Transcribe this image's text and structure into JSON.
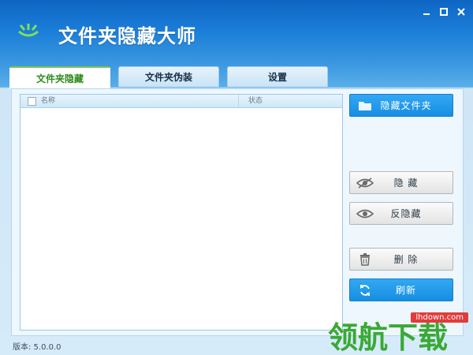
{
  "app": {
    "title": "文件夹隐藏大师",
    "version_label": "版本: 5.0.0.0"
  },
  "window_controls": [
    "minimize-icon",
    "maximize-icon",
    "close-icon"
  ],
  "tabs": [
    {
      "label": "文件夹隐藏",
      "active": true
    },
    {
      "label": "文件夹伪装",
      "active": false
    },
    {
      "label": "设置",
      "active": false
    }
  ],
  "table": {
    "columns": [
      "名称",
      "状态"
    ],
    "rows": []
  },
  "actions": {
    "hide_folder": "隐藏文件夹",
    "hide": "隐 藏",
    "unhide": "反隐藏",
    "delete": "删 除",
    "refresh": "刷新"
  },
  "icons": {
    "hide_folder": "folder-icon",
    "hide": "eye-slash-icon",
    "unhide": "eye-icon",
    "delete": "trash-icon",
    "refresh": "refresh-icon"
  },
  "colors": {
    "accent_blue": "#168fe2",
    "tab_active_text": "#2e8a1c",
    "titlebar": "#1b7ed8"
  },
  "watermark": {
    "url": "lhdown.com",
    "text": "领航下载"
  }
}
